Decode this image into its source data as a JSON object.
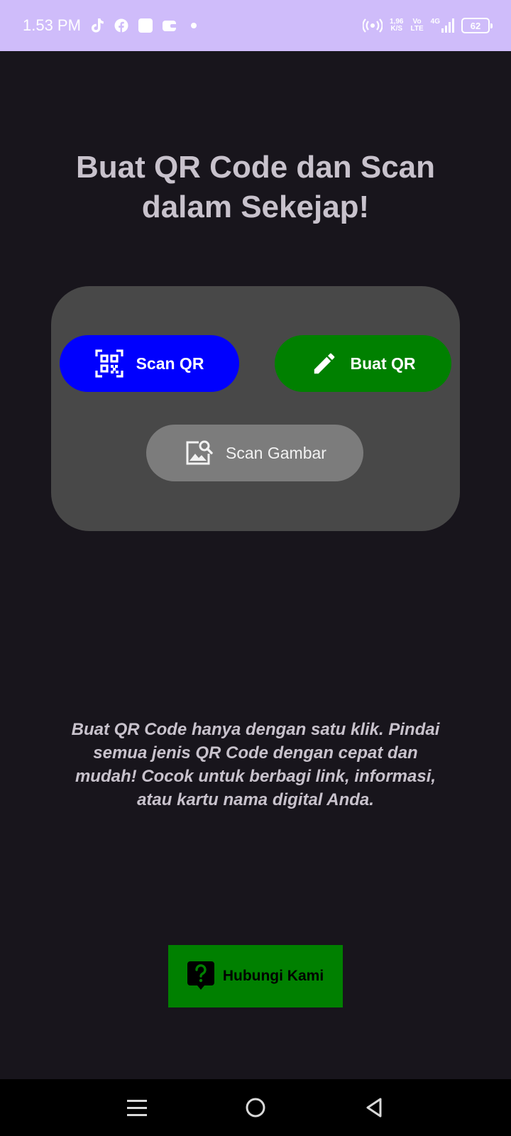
{
  "status_bar": {
    "time": "1.53 PM",
    "net_speed_value": "1,96",
    "net_speed_unit": "K/S",
    "volte_top": "Vo",
    "volte_bottom": "LTE",
    "network_type": "4G",
    "battery_level": "62",
    "notification_icons": [
      "tiktok-icon",
      "facebook-icon",
      "square-app-icon",
      "wallet-icon",
      "dot-icon"
    ]
  },
  "main": {
    "headline": "Buat QR Code dan Scan dalam Sekejap!",
    "buttons": {
      "scan_qr": "Scan QR",
      "buat_qr": "Buat QR",
      "scan_gambar": "Scan Gambar"
    },
    "description": "Buat QR Code hanya dengan satu klik. Pindai semua jenis QR Code dengan cepat dan mudah! Cocok untuk berbagi link, informasi, atau kartu nama digital Anda.",
    "contact_label": "Hubungi Kami"
  },
  "colors": {
    "status_bar": "#cfbcfa",
    "background": "#18151c",
    "card": "#484848",
    "scan_button": "#0000fe",
    "buat_button": "#008000",
    "gambar_button": "#7c7c7c",
    "contact_button": "#008000"
  },
  "nav_bar": {
    "icons": [
      "recent-apps-icon",
      "home-icon",
      "back-icon"
    ]
  }
}
